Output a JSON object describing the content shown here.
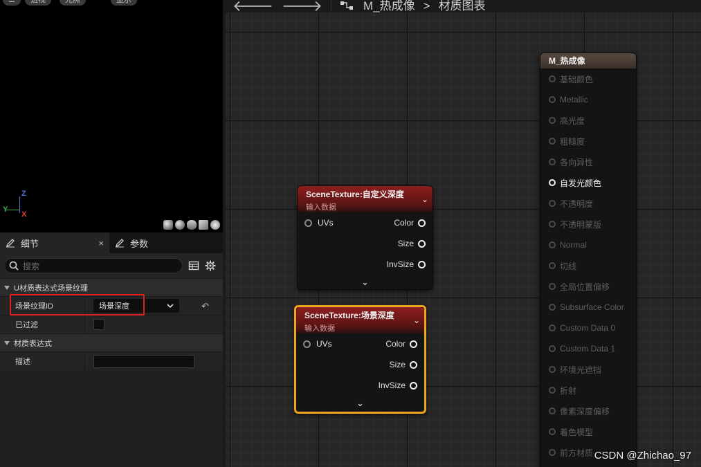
{
  "viewport": {
    "pills": [
      "透视",
      "光照",
      "显示"
    ],
    "axes": {
      "z": "Z",
      "y": "Y",
      "x": "X"
    }
  },
  "details": {
    "tab_details": "细节",
    "tab_close": "×",
    "tab_params": "参数",
    "search_placeholder": "搜索",
    "section1": "U材质表达式场景纹理",
    "prop_scene_texture_id": "场景纹理ID",
    "prop_scene_texture_id_value": "场景深度",
    "prop_filtered": "已过滤",
    "section2": "材质表达式",
    "prop_description": "描述"
  },
  "toolbar": {
    "breadcrumb_material": "M_热成像",
    "breadcrumb_sep": ">",
    "breadcrumb_graph": "材质图表"
  },
  "nodes": [
    {
      "title": "SceneTexture:自定义深度",
      "subtitle": "输入数据",
      "input": "UVs",
      "outputs": [
        "Color",
        "Size",
        "InvSize"
      ]
    },
    {
      "title": "SceneTexture:场景深度",
      "subtitle": "输入数据",
      "input": "UVs",
      "outputs": [
        "Color",
        "Size",
        "InvSize"
      ]
    }
  ],
  "result_node": {
    "title": "M_热成像",
    "pins": [
      "基础颜色",
      "Metallic",
      "高光度",
      "粗糙度",
      "各向异性",
      "自发光颜色",
      "不透明度",
      "不透明蒙版",
      "Normal",
      "切线",
      "全局位置偏移",
      "Subsurface Color",
      "Custom Data 0",
      "Custom Data 1",
      "环境光遮挡",
      "折射",
      "像素深度偏移",
      "着色模型",
      "前方材质"
    ],
    "active_pin": "自发光颜色"
  },
  "watermark": "CSDN @Zhichao_97",
  "colors": {
    "node_header": "#8e1e1e",
    "selection": "#f0a41e",
    "highlight_box": "#e02020"
  }
}
